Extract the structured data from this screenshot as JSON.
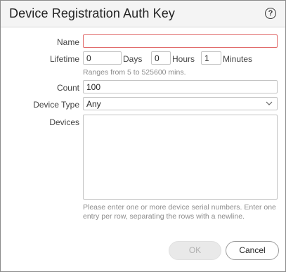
{
  "dialog": {
    "title": "Device Registration Auth Key",
    "help_icon": "question-circle-icon"
  },
  "form": {
    "name": {
      "label": "Name",
      "value": ""
    },
    "lifetime": {
      "label": "Lifetime",
      "days": {
        "value": "0",
        "unit": "Days"
      },
      "hours": {
        "value": "0",
        "unit": "Hours"
      },
      "minutes": {
        "value": "1",
        "unit": "Minutes"
      },
      "hint": "Ranges from 5 to 525600 mins."
    },
    "count": {
      "label": "Count",
      "value": "100"
    },
    "device_type": {
      "label": "Device Type",
      "value": "Any",
      "icon": "chevron-down-icon"
    },
    "devices": {
      "label": "Devices",
      "value": "",
      "hint_line1": "Please enter one or more device serial numbers. Enter one",
      "hint_line2": "entry per row, separating the rows with a newline."
    }
  },
  "buttons": {
    "ok": "OK",
    "cancel": "Cancel"
  },
  "colors": {
    "required_border": "#e06a6a",
    "title_bar": "#f4f4f4",
    "disabled_button": "#e9e9e9"
  }
}
